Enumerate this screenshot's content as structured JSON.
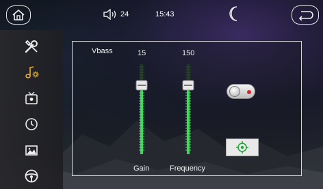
{
  "status": {
    "volume": "24",
    "time": "15:43"
  },
  "colors": {
    "accent": "#3fd65a",
    "sidebar_active": "#e8ad2f",
    "toggle_dot": "#d9262c"
  },
  "sidebar": {
    "items": [
      {
        "icon": "tools-icon",
        "active": false
      },
      {
        "icon": "music-settings-icon",
        "active": true
      },
      {
        "icon": "tv-icon",
        "active": false
      },
      {
        "icon": "clock-icon",
        "active": false
      },
      {
        "icon": "picture-icon",
        "active": false
      },
      {
        "icon": "steering-wheel-icon",
        "active": false
      }
    ]
  },
  "eq": {
    "title": "Vbass",
    "gain": {
      "value": "15",
      "label": "Gain"
    },
    "frequency": {
      "value": "150",
      "label": "Frequency"
    }
  },
  "vbass_toggle": {
    "on": false
  }
}
